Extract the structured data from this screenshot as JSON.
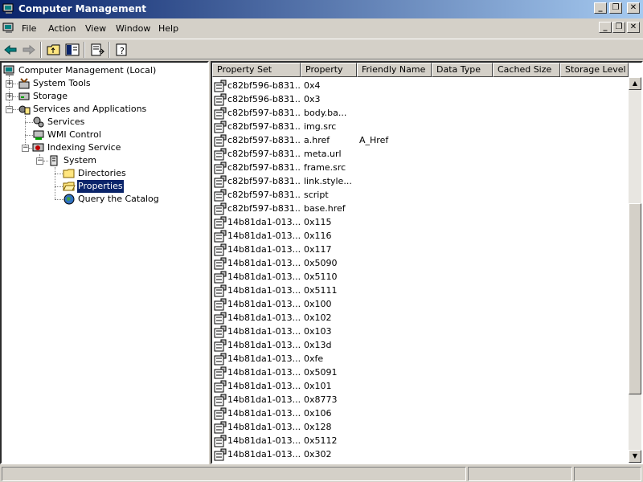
{
  "window": {
    "title": "Computer Management"
  },
  "menu": {
    "file": "File",
    "action": "Action",
    "view": "View",
    "window": "Window",
    "help": "Help"
  },
  "tree": {
    "root": "Computer Management (Local)",
    "system_tools": "System Tools",
    "storage": "Storage",
    "services_apps": "Services and Applications",
    "services": "Services",
    "wmi": "WMI Control",
    "indexing": "Indexing Service",
    "system": "System",
    "directories": "Directories",
    "properties": "Properties",
    "query": "Query the Catalog"
  },
  "columns": [
    "Property Set",
    "Property",
    "Friendly Name",
    "Data Type",
    "Cached Size",
    "Storage Level"
  ],
  "rows": [
    {
      "set": "c82bf596-b831...",
      "prop": "0x4",
      "friendly": ""
    },
    {
      "set": "c82bf596-b831...",
      "prop": "0x3",
      "friendly": ""
    },
    {
      "set": "c82bf597-b831...",
      "prop": "body.ba...",
      "friendly": ""
    },
    {
      "set": "c82bf597-b831...",
      "prop": "img.src",
      "friendly": ""
    },
    {
      "set": "c82bf597-b831...",
      "prop": "a.href",
      "friendly": "A_Href"
    },
    {
      "set": "c82bf597-b831...",
      "prop": "meta.url",
      "friendly": ""
    },
    {
      "set": "c82bf597-b831...",
      "prop": "frame.src",
      "friendly": ""
    },
    {
      "set": "c82bf597-b831...",
      "prop": "link.style...",
      "friendly": ""
    },
    {
      "set": "c82bf597-b831...",
      "prop": "script",
      "friendly": ""
    },
    {
      "set": "c82bf597-b831...",
      "prop": "base.href",
      "friendly": ""
    },
    {
      "set": "14b81da1-013...",
      "prop": "0x115",
      "friendly": ""
    },
    {
      "set": "14b81da1-013...",
      "prop": "0x116",
      "friendly": ""
    },
    {
      "set": "14b81da1-013...",
      "prop": "0x117",
      "friendly": ""
    },
    {
      "set": "14b81da1-013...",
      "prop": "0x5090",
      "friendly": ""
    },
    {
      "set": "14b81da1-013...",
      "prop": "0x5110",
      "friendly": ""
    },
    {
      "set": "14b81da1-013...",
      "prop": "0x5111",
      "friendly": ""
    },
    {
      "set": "14b81da1-013...",
      "prop": "0x100",
      "friendly": ""
    },
    {
      "set": "14b81da1-013...",
      "prop": "0x102",
      "friendly": ""
    },
    {
      "set": "14b81da1-013...",
      "prop": "0x103",
      "friendly": ""
    },
    {
      "set": "14b81da1-013...",
      "prop": "0x13d",
      "friendly": ""
    },
    {
      "set": "14b81da1-013...",
      "prop": "0xfe",
      "friendly": ""
    },
    {
      "set": "14b81da1-013...",
      "prop": "0x5091",
      "friendly": ""
    },
    {
      "set": "14b81da1-013...",
      "prop": "0x101",
      "friendly": ""
    },
    {
      "set": "14b81da1-013...",
      "prop": "0x8773",
      "friendly": ""
    },
    {
      "set": "14b81da1-013...",
      "prop": "0x106",
      "friendly": ""
    },
    {
      "set": "14b81da1-013...",
      "prop": "0x128",
      "friendly": ""
    },
    {
      "set": "14b81da1-013...",
      "prop": "0x5112",
      "friendly": ""
    },
    {
      "set": "14b81da1-013...",
      "prop": "0x302",
      "friendly": ""
    }
  ],
  "icons": {
    "back": "back-arrow-icon",
    "forward": "forward-arrow-icon",
    "up": "up-folder-icon",
    "show_tree": "show-hide-tree-icon",
    "export": "export-list-icon",
    "help": "help-icon"
  },
  "colors": {
    "titlebar_start": "#0a246a",
    "titlebar_end": "#a6caf0",
    "selection": "#0a246a",
    "face": "#d4d0c8"
  }
}
